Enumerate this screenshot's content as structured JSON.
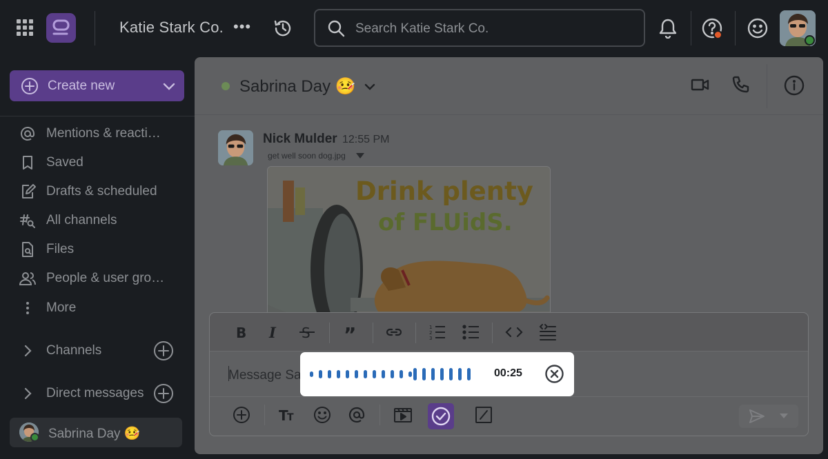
{
  "workspace": {
    "name": "Katie Stark Co.",
    "more": "•••"
  },
  "search": {
    "placeholder": "Search Katie Stark Co."
  },
  "sidebar": {
    "create_label": "Create new",
    "items": [
      {
        "label": "Mentions & reacti…",
        "icon": "at-icon"
      },
      {
        "label": "Saved",
        "icon": "bookmark-icon"
      },
      {
        "label": "Drafts & scheduled",
        "icon": "pencil-icon"
      },
      {
        "label": "All channels",
        "icon": "channel-search-icon"
      },
      {
        "label": "Files",
        "icon": "file-search-icon"
      },
      {
        "label": "People & user gro…",
        "icon": "people-icon"
      },
      {
        "label": "More",
        "icon": "more-vertical-icon"
      }
    ],
    "channels_label": "Channels",
    "dm_label": "Direct messages",
    "current_user": "Sabrina Day 🤒"
  },
  "channel": {
    "title": "Sabrina Day 🤒"
  },
  "message": {
    "author": "Nick Mulder",
    "time": "12:55 PM",
    "file_name": "get well soon dog.jpg",
    "image_text_line1": "Drink plenty",
    "image_text_line2": "of FLUidS."
  },
  "composer": {
    "placeholder": "Message Sabrina Day 🤒"
  },
  "recorder": {
    "time": "00:25"
  },
  "colors": {
    "accent": "#5a3d8a",
    "online": "#3a8a3c",
    "alert": "#e25a2a",
    "wave": "#2a6bb8"
  }
}
